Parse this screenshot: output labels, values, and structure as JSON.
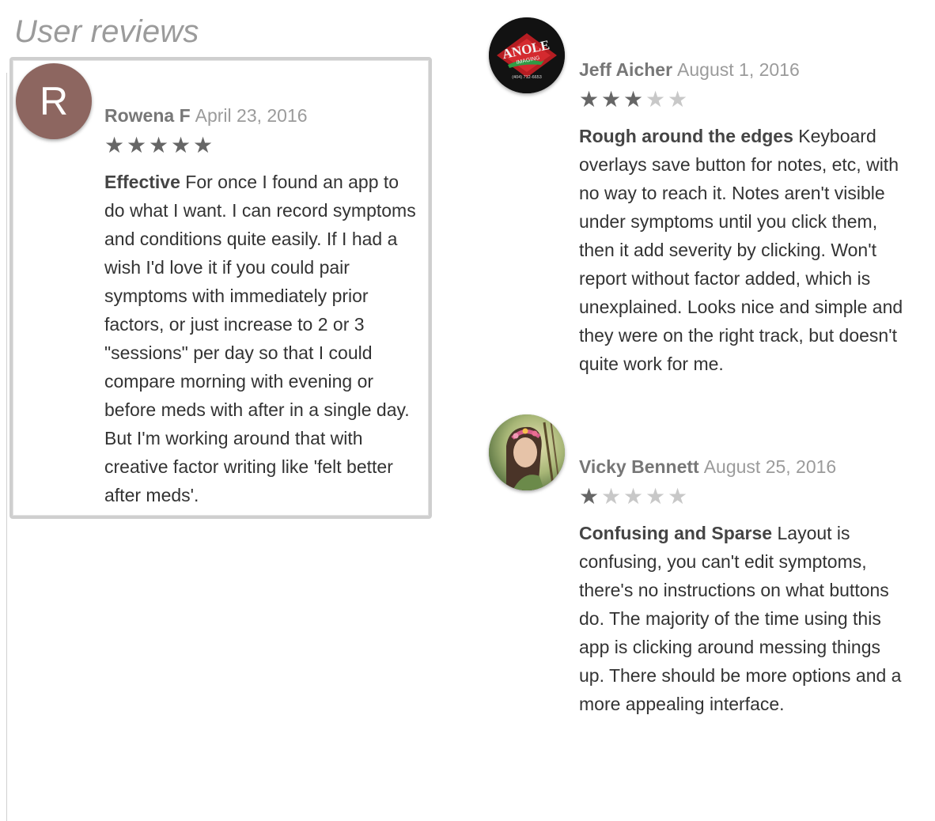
{
  "section_title": "User reviews",
  "colors": {
    "avatar_letter_bg": "#8d6660",
    "star_on": "#666666",
    "star_off": "#c8c8c8",
    "focus_border": "#cfcfcf"
  },
  "reviews": [
    {
      "author": "Rowena F",
      "date": "April 23, 2016",
      "rating": 5,
      "avatar_letter": "R",
      "title": "Effective",
      "text": "For once I found an app to do what I want. I can record symptoms and conditions quite easily. If I had a wish I'd love it if you could pair symptoms with immediately prior factors, or just increase to 2 or 3 \"sessions\" per day so that I could compare morning with evening or before meds with after in a single day. But I'm working around that with creative factor writing like 'felt better after meds'."
    },
    {
      "author": "Jeff Aicher",
      "date": "August 1, 2016",
      "rating": 3,
      "avatar_logo_text": "ANOLE",
      "avatar_logo_sub": "IMAGING",
      "avatar_logo_phone": "(404) 712-6653",
      "title": "Rough around the edges",
      "text": "Keyboard overlays save button for notes, etc, with no way to reach it. Notes aren't visible under symptoms until you click them, then it add severity by clicking. Won't report without factor added, which is unexplained. Looks nice and simple and they were on the right track, but doesn't quite work for me."
    },
    {
      "author": "Vicky Bennett",
      "date": "August 25, 2016",
      "rating": 1,
      "avatar_icon": "portrait-photo",
      "title": "Confusing and Sparse",
      "text": "Layout is confusing, you can't edit symptoms, there's no instructions on what buttons do. The majority of the time using this app is clicking around messing things up. There should be more options and a more appealing interface."
    }
  ]
}
